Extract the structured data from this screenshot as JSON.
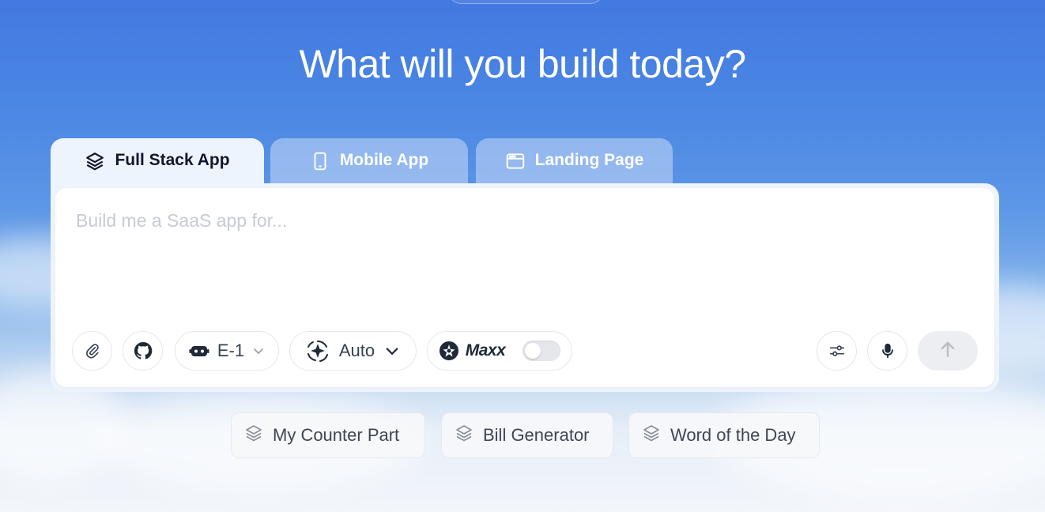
{
  "hero": {
    "title": "What will you build today?"
  },
  "tabs": [
    {
      "label": "Full Stack App",
      "icon": "layers-icon",
      "active": true
    },
    {
      "label": "Mobile App",
      "icon": "smartphone-icon",
      "active": false
    },
    {
      "label": "Landing Page",
      "icon": "browser-window-icon",
      "active": false
    }
  ],
  "prompt": {
    "placeholder": "Build me a SaaS app for...",
    "value": ""
  },
  "toolbar": {
    "model_label": "E-1",
    "mode_label": "Auto",
    "maxx_label": "Maxx",
    "maxx_enabled": false
  },
  "suggestions": [
    {
      "label": "My Counter Part",
      "icon": "layers-icon"
    },
    {
      "label": "Bill Generator",
      "icon": "layers-icon"
    },
    {
      "label": "Word of the Day",
      "icon": "layers-icon"
    }
  ],
  "colors": {
    "background_top": "#4379e0",
    "background_bottom": "#f3f6fb",
    "active_tab": "#eef4fd",
    "send_button": "#eceef1"
  }
}
